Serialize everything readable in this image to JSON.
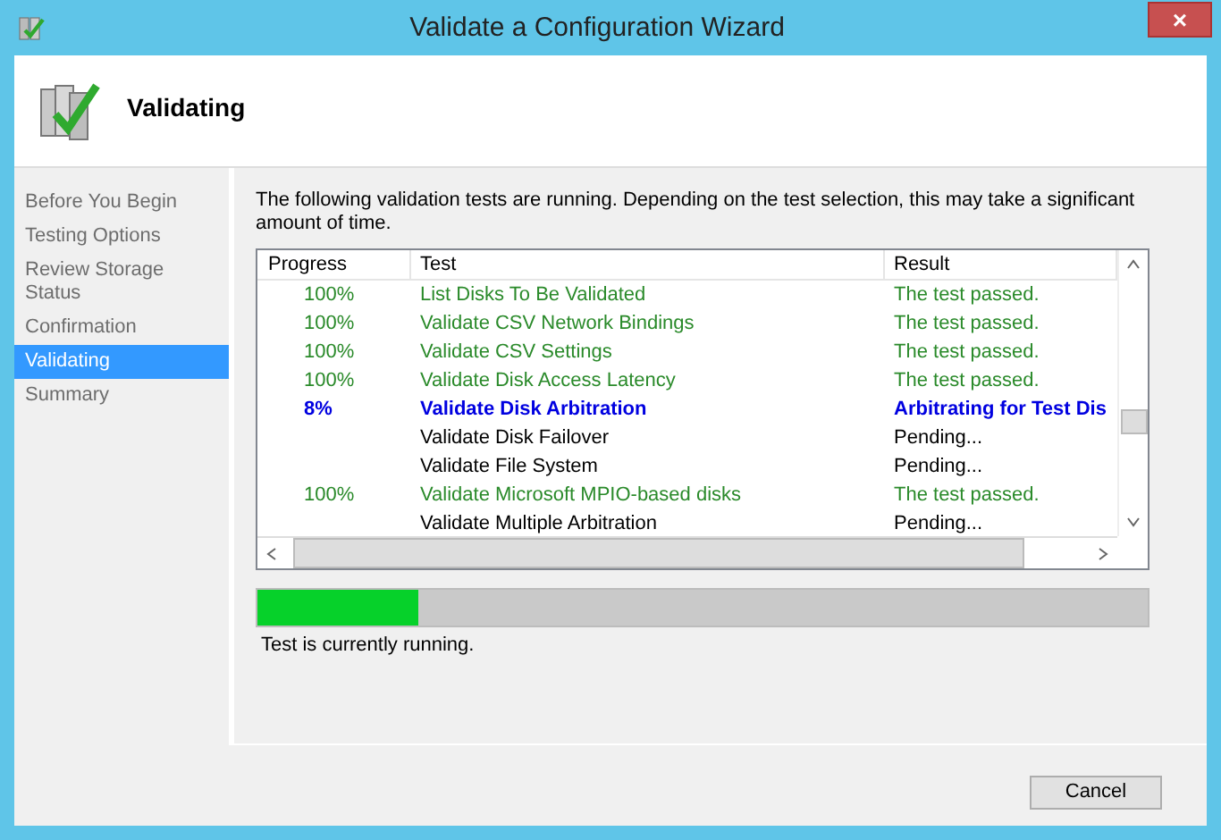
{
  "window": {
    "title": "Validate a Configuration Wizard",
    "close": "×"
  },
  "header": {
    "title": "Validating"
  },
  "steps": [
    {
      "label": "Before You Begin",
      "selected": false
    },
    {
      "label": "Testing Options",
      "selected": false
    },
    {
      "label": "Review Storage Status",
      "selected": false
    },
    {
      "label": "Confirmation",
      "selected": false
    },
    {
      "label": "Validating",
      "selected": true
    },
    {
      "label": "Summary",
      "selected": false
    }
  ],
  "intro": "The following validation tests are running. Depending on the test selection, this may take a significant amount of time.",
  "table": {
    "columns": [
      "Progress",
      "Test",
      "Result"
    ],
    "rows": [
      {
        "progress": "100%",
        "test": "List Disks To Be Validated",
        "result": "The test passed.",
        "kind": "passed"
      },
      {
        "progress": "100%",
        "test": "Validate CSV Network Bindings",
        "result": "The test passed.",
        "kind": "passed"
      },
      {
        "progress": "100%",
        "test": "Validate CSV Settings",
        "result": "The test passed.",
        "kind": "passed"
      },
      {
        "progress": "100%",
        "test": "Validate Disk Access Latency",
        "result": "The test passed.",
        "kind": "passed"
      },
      {
        "progress": "8%",
        "test": "Validate Disk Arbitration",
        "result": "Arbitrating for Test Dis",
        "kind": "running"
      },
      {
        "test": "Validate Disk Failover",
        "result": "Pending...",
        "kind": "pending"
      },
      {
        "test": "Validate File System",
        "result": "Pending...",
        "kind": "pending"
      },
      {
        "progress": "100%",
        "test": "Validate Microsoft MPIO-based disks",
        "result": "The test passed.",
        "kind": "passed"
      },
      {
        "test": "Validate Multiple Arbitration",
        "result": "Pending...",
        "kind": "pending"
      }
    ]
  },
  "progress": {
    "level": 0.18
  },
  "status_text": "Test is currently running.",
  "buttons": [
    "Cancel"
  ]
}
